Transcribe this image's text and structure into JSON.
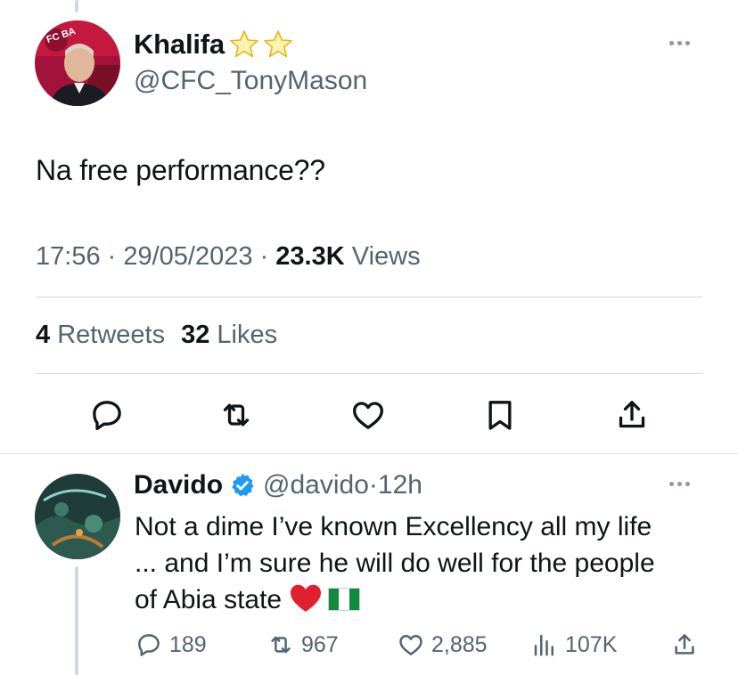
{
  "main_tweet": {
    "author_name": "Khalifa",
    "name_emojis": [
      "star-emoji",
      "star-emoji"
    ],
    "handle": "@CFC_TonyMason",
    "avatar_badge_text": "FC BA",
    "text": "Na free performance??",
    "time": "17:56",
    "date": "29/05/2023",
    "views_count": "23.3K",
    "views_label": "Views",
    "retweets_count": "4",
    "retweets_label": "Retweets",
    "likes_count": "32",
    "likes_label": "Likes",
    "actions": [
      "reply-icon",
      "retweet-icon",
      "like-icon",
      "bookmark-icon",
      "share-icon"
    ]
  },
  "reply": {
    "author_name": "Davido",
    "verified": true,
    "handle": "@davido",
    "time": "12h",
    "text_lines": [
      "Not a dime I’ve known Excellency all my life",
      "... and I’m sure he will do well for the people",
      "of Abia state"
    ],
    "text_emojis": [
      "red-heart-emoji",
      "nigeria-flag-emoji"
    ],
    "reply_count": "189",
    "retweet_count": "967",
    "like_count": "2,885",
    "view_count": "107K"
  },
  "colors": {
    "text_primary": "#0f1419",
    "text_secondary": "#536471",
    "verified_blue": "#1d9bf0",
    "divider": "#cfd9de"
  }
}
